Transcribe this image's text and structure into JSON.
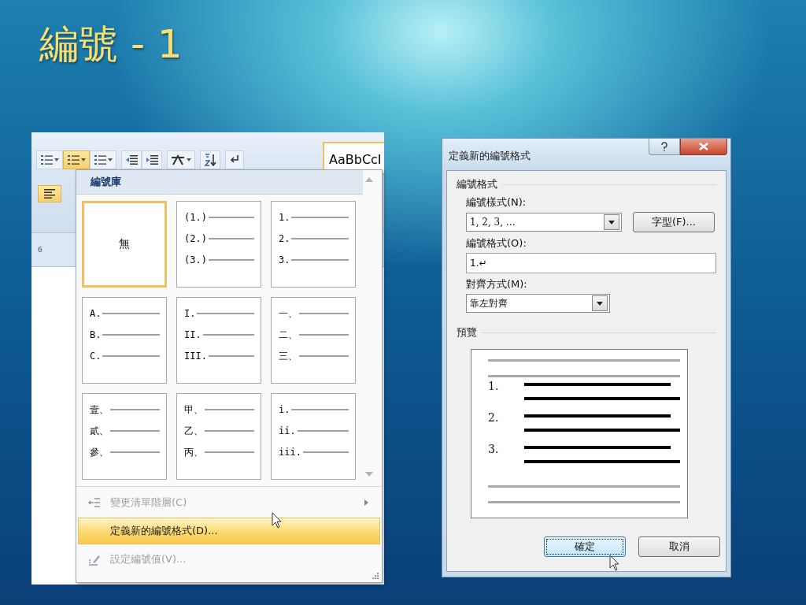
{
  "title": "編號 - 1",
  "word": {
    "toolbar": [
      {
        "kind": "bullets",
        "selected": false
      },
      {
        "kind": "numbering",
        "selected": true
      },
      {
        "kind": "multilevel",
        "selected": false
      },
      {
        "kind": "decrease-indent",
        "selected": false
      },
      {
        "kind": "increase-indent",
        "selected": false
      },
      {
        "kind": "asian-layout",
        "selected": false
      },
      {
        "kind": "sort",
        "selected": false
      },
      {
        "kind": "paragraph-mark",
        "selected": false
      }
    ],
    "align_buttons": [
      {
        "kind": "align-left",
        "selected": true
      }
    ],
    "style_preview": "AaBbCcI",
    "ruler_mark": "6",
    "menu": {
      "heading": "編號庫",
      "gallery": [
        {
          "kind": "none",
          "label": "無",
          "selected": true
        },
        {
          "kind": "list",
          "markers": [
            "(1.)",
            "(2.)",
            "(3.)"
          ],
          "selected": false
        },
        {
          "kind": "list",
          "markers": [
            "1.",
            "2.",
            "3."
          ],
          "selected": false
        },
        {
          "kind": "list",
          "markers": [
            "A.",
            "B.",
            "C."
          ],
          "selected": false
        },
        {
          "kind": "list",
          "markers": [
            "I.",
            "II.",
            "III."
          ],
          "selected": false
        },
        {
          "kind": "list",
          "markers": [
            "一、",
            "二、",
            "三、"
          ],
          "selected": false
        },
        {
          "kind": "list",
          "markers": [
            "壹、",
            "貳、",
            "參、"
          ],
          "selected": false
        },
        {
          "kind": "list",
          "markers": [
            "甲、",
            "乙、",
            "丙、"
          ],
          "selected": false
        },
        {
          "kind": "list",
          "markers": [
            "i.",
            "ii.",
            "iii."
          ],
          "selected": false
        }
      ],
      "items": [
        {
          "kind": "change-level",
          "label": "變更清單階層(C)",
          "disabled": true,
          "selected": false,
          "submenu": true
        },
        {
          "kind": "define",
          "label": "定義新的編號格式(D)...",
          "disabled": false,
          "selected": true,
          "submenu": false
        },
        {
          "kind": "set-value",
          "label": "設定編號值(V)...",
          "disabled": true,
          "selected": false,
          "submenu": false
        }
      ]
    }
  },
  "dialog": {
    "title": "定義新的編號格式",
    "group": "編號格式",
    "style_label": "編號樣式(N):",
    "style_value": "1, 2, 3, …",
    "font_button": "字型(F)...",
    "format_label": "編號格式(O):",
    "format_value": "1.↵",
    "align_label": "對齊方式(M):",
    "align_value": "靠左對齊",
    "preview_label": "預覽",
    "preview_markers": [
      "1.",
      "2.",
      "3."
    ],
    "buttons": [
      {
        "label": "確定",
        "focused": true
      },
      {
        "label": "取消",
        "focused": false
      }
    ]
  }
}
